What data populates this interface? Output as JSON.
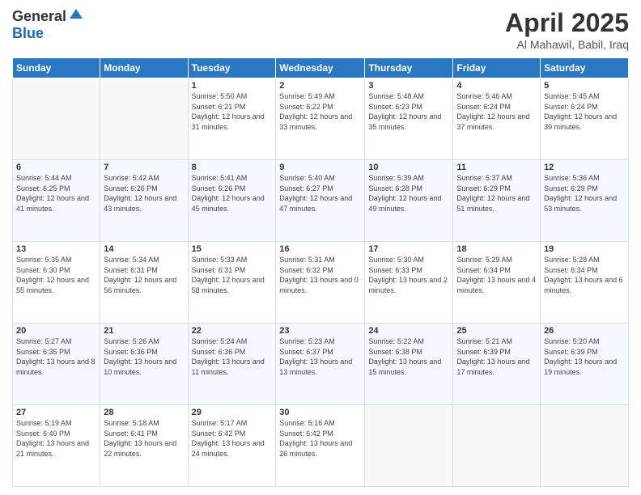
{
  "logo": {
    "general": "General",
    "blue": "Blue"
  },
  "title": "April 2025",
  "location": "Al Mahawil, Babil, Iraq",
  "weekdays": [
    "Sunday",
    "Monday",
    "Tuesday",
    "Wednesday",
    "Thursday",
    "Friday",
    "Saturday"
  ],
  "weeks": [
    [
      {
        "day": "",
        "info": ""
      },
      {
        "day": "",
        "info": ""
      },
      {
        "day": "1",
        "info": "Sunrise: 5:50 AM\nSunset: 6:21 PM\nDaylight: 12 hours and 31 minutes."
      },
      {
        "day": "2",
        "info": "Sunrise: 5:49 AM\nSunset: 6:22 PM\nDaylight: 12 hours and 33 minutes."
      },
      {
        "day": "3",
        "info": "Sunrise: 5:48 AM\nSunset: 6:23 PM\nDaylight: 12 hours and 35 minutes."
      },
      {
        "day": "4",
        "info": "Sunrise: 5:46 AM\nSunset: 6:24 PM\nDaylight: 12 hours and 37 minutes."
      },
      {
        "day": "5",
        "info": "Sunrise: 5:45 AM\nSunset: 6:24 PM\nDaylight: 12 hours and 39 minutes."
      }
    ],
    [
      {
        "day": "6",
        "info": "Sunrise: 5:44 AM\nSunset: 6:25 PM\nDaylight: 12 hours and 41 minutes."
      },
      {
        "day": "7",
        "info": "Sunrise: 5:42 AM\nSunset: 6:26 PM\nDaylight: 12 hours and 43 minutes."
      },
      {
        "day": "8",
        "info": "Sunrise: 5:41 AM\nSunset: 6:26 PM\nDaylight: 12 hours and 45 minutes."
      },
      {
        "day": "9",
        "info": "Sunrise: 5:40 AM\nSunset: 6:27 PM\nDaylight: 12 hours and 47 minutes."
      },
      {
        "day": "10",
        "info": "Sunrise: 5:39 AM\nSunset: 6:28 PM\nDaylight: 12 hours and 49 minutes."
      },
      {
        "day": "11",
        "info": "Sunrise: 5:37 AM\nSunset: 6:29 PM\nDaylight: 12 hours and 51 minutes."
      },
      {
        "day": "12",
        "info": "Sunrise: 5:36 AM\nSunset: 6:29 PM\nDaylight: 12 hours and 53 minutes."
      }
    ],
    [
      {
        "day": "13",
        "info": "Sunrise: 5:35 AM\nSunset: 6:30 PM\nDaylight: 12 hours and 55 minutes."
      },
      {
        "day": "14",
        "info": "Sunrise: 5:34 AM\nSunset: 6:31 PM\nDaylight: 12 hours and 56 minutes."
      },
      {
        "day": "15",
        "info": "Sunrise: 5:33 AM\nSunset: 6:31 PM\nDaylight: 12 hours and 58 minutes."
      },
      {
        "day": "16",
        "info": "Sunrise: 5:31 AM\nSunset: 6:32 PM\nDaylight: 13 hours and 0 minutes."
      },
      {
        "day": "17",
        "info": "Sunrise: 5:30 AM\nSunset: 6:33 PM\nDaylight: 13 hours and 2 minutes."
      },
      {
        "day": "18",
        "info": "Sunrise: 5:29 AM\nSunset: 6:34 PM\nDaylight: 13 hours and 4 minutes."
      },
      {
        "day": "19",
        "info": "Sunrise: 5:28 AM\nSunset: 6:34 PM\nDaylight: 13 hours and 6 minutes."
      }
    ],
    [
      {
        "day": "20",
        "info": "Sunrise: 5:27 AM\nSunset: 6:35 PM\nDaylight: 13 hours and 8 minutes."
      },
      {
        "day": "21",
        "info": "Sunrise: 5:26 AM\nSunset: 6:36 PM\nDaylight: 13 hours and 10 minutes."
      },
      {
        "day": "22",
        "info": "Sunrise: 5:24 AM\nSunset: 6:36 PM\nDaylight: 13 hours and 11 minutes."
      },
      {
        "day": "23",
        "info": "Sunrise: 5:23 AM\nSunset: 6:37 PM\nDaylight: 13 hours and 13 minutes."
      },
      {
        "day": "24",
        "info": "Sunrise: 5:22 AM\nSunset: 6:38 PM\nDaylight: 13 hours and 15 minutes."
      },
      {
        "day": "25",
        "info": "Sunrise: 5:21 AM\nSunset: 6:39 PM\nDaylight: 13 hours and 17 minutes."
      },
      {
        "day": "26",
        "info": "Sunrise: 5:20 AM\nSunset: 6:39 PM\nDaylight: 13 hours and 19 minutes."
      }
    ],
    [
      {
        "day": "27",
        "info": "Sunrise: 5:19 AM\nSunset: 6:40 PM\nDaylight: 13 hours and 21 minutes."
      },
      {
        "day": "28",
        "info": "Sunrise: 5:18 AM\nSunset: 6:41 PM\nDaylight: 13 hours and 22 minutes."
      },
      {
        "day": "29",
        "info": "Sunrise: 5:17 AM\nSunset: 6:42 PM\nDaylight: 13 hours and 24 minutes."
      },
      {
        "day": "30",
        "info": "Sunrise: 5:16 AM\nSunset: 6:42 PM\nDaylight: 13 hours and 26 minutes."
      },
      {
        "day": "",
        "info": ""
      },
      {
        "day": "",
        "info": ""
      },
      {
        "day": "",
        "info": ""
      }
    ]
  ]
}
